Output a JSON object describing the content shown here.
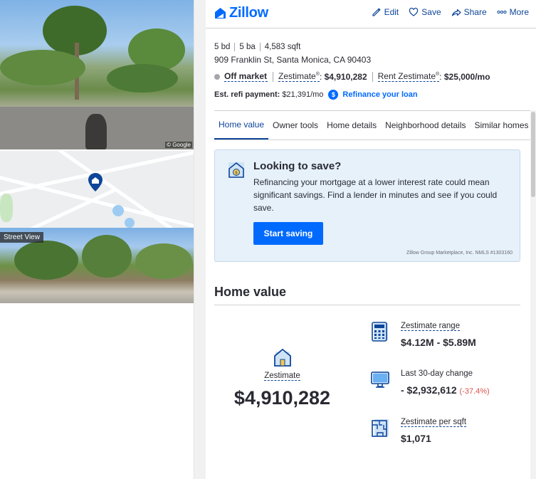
{
  "left_panel": {
    "photo_credit": "© Google",
    "street_view_label": "Street View"
  },
  "header": {
    "brand": "Zillow",
    "actions": {
      "edit": "Edit",
      "save": "Save",
      "share": "Share",
      "more": "More"
    }
  },
  "listing": {
    "beds": "5 bd",
    "baths": "5 ba",
    "sqft": "4,583 sqft",
    "address": "909 Franklin St, Santa Monica, CA 90403",
    "status": "Off market",
    "zestimate_label": "Zestimate",
    "zestimate_value": "$4,910,282",
    "rent_label": "Rent Zestimate",
    "rent_value": "$25,000/mo",
    "refi_label": "Est. refi payment:",
    "refi_value": "$21,391/mo",
    "refi_link": "Refinance your loan"
  },
  "tabs": [
    "Home value",
    "Owner tools",
    "Home details",
    "Neighborhood details",
    "Similar homes"
  ],
  "promo": {
    "title": "Looking to save?",
    "body": "Refinancing your mortgage at a lower interest rate could mean significant savings. Find a lender in minutes and see if you could save.",
    "button": "Start saving",
    "disclaimer": "Zillow Group Marketplace, Inc. NMLS #1303160"
  },
  "home_value": {
    "title": "Home value",
    "zestimate_label": "Zestimate",
    "zestimate_value": "$4,910,282",
    "range_label": "Zestimate range",
    "range_value": "$4.12M - $5.89M",
    "change_label": "Last 30-day change",
    "change_value": "- $2,932,612",
    "change_pct": "(-37.4%)",
    "per_sqft_label": "Zestimate per sqft",
    "per_sqft_value": "$1,071"
  },
  "colors": {
    "brand_blue": "#006aff",
    "link_blue": "#0d4599",
    "highlight": "#f6ff00",
    "negative": "#d9534f"
  }
}
